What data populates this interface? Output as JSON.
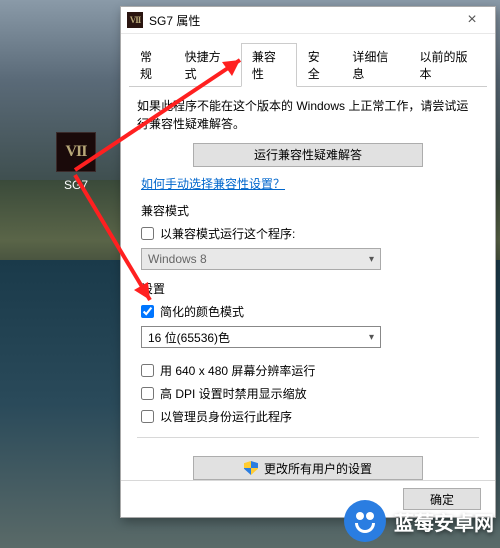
{
  "desktop": {
    "icon_label": "SG7"
  },
  "dialog": {
    "title": "SG7 属性",
    "tabs": [
      "常规",
      "快捷方式",
      "兼容性",
      "安全",
      "详细信息",
      "以前的版本"
    ],
    "active_tab_index": 2,
    "intro": "如果此程序不能在这个版本的 Windows 上正常工作，请尝试运行兼容性疑难解答。",
    "troubleshoot_button": "运行兼容性疑难解答",
    "help_link": "如何手动选择兼容性设置？",
    "compat_mode": {
      "title": "兼容模式",
      "checkbox_label": "以兼容模式运行这个程序:",
      "checked": false,
      "select_value": "Windows 8"
    },
    "settings": {
      "title": "设置",
      "reduced_color": {
        "label": "简化的颜色模式",
        "checked": true
      },
      "color_select_value": "16 位(65536)色",
      "res_640": {
        "label": "用 640 x 480 屏幕分辨率运行",
        "checked": false
      },
      "high_dpi": {
        "label": "高 DPI 设置时禁用显示缩放",
        "checked": false
      },
      "run_admin": {
        "label": "以管理员身份运行此程序",
        "checked": false
      }
    },
    "all_users_button": "更改所有用户的设置",
    "ok_button": "确定"
  },
  "watermark": {
    "text": "蓝莓安卓网"
  }
}
